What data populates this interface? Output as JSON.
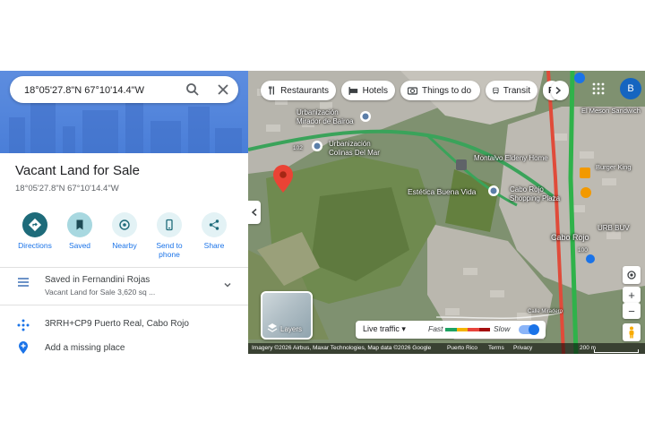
{
  "search": {
    "value": "18°05'27.8\"N 67°10'14.4\"W"
  },
  "place": {
    "title": "Vacant Land for Sale",
    "coordinates": "18°05'27.8\"N 67°10'14.4\"W"
  },
  "actions": [
    {
      "label": "Directions",
      "icon": "directions-icon"
    },
    {
      "label": "Saved",
      "icon": "bookmark-icon"
    },
    {
      "label": "Nearby",
      "icon": "nearby-icon"
    },
    {
      "label": "Send to phone",
      "icon": "phone-icon"
    },
    {
      "label": "Share",
      "icon": "share-icon"
    }
  ],
  "saved": {
    "line1": "Saved in Fernandini Rojas",
    "line2": "Vacant Land for Sale 3,620 sq ..."
  },
  "plus_code": "3RRH+CP9 Puerto Real, Cabo Rojo",
  "add_place": "Add a missing place",
  "map": {
    "chips": [
      "Restaurants",
      "Hotels",
      "Things to do",
      "Transit",
      "P"
    ],
    "avatar": "B",
    "layers_label": "Layers",
    "traffic": {
      "live": "Live traffic",
      "fast": "Fast",
      "slow": "Slow"
    },
    "labels": {
      "mirador": "Urbanización\nMirador de Bairoa",
      "colinas": "Urbanización\nColinas Del Mar",
      "montalvo": "Montalvo Eldeny Home",
      "estetica": "Estética Buena Vida",
      "cabo_plaza": "Cabo Rojo\nShopping Plaza",
      "cabo": "Cabo Rojo",
      "urb": "URB BUV",
      "calle": "Calle Miradero",
      "meson": "El Meson Sandwich",
      "burger": "Burger King",
      "road102": "102",
      "road100": "100"
    },
    "footer": {
      "imagery": "Imagery ©2026 Airbus, Maxar Technologies, Map data ©2026 Google",
      "region": "Puerto Rico",
      "terms": "Terms",
      "privacy": "Privacy",
      "scale": "200 m"
    }
  },
  "colors": {
    "accent": "#1a73e8",
    "teal": "#1e6b7a",
    "pin": "#ea4335",
    "highway": "#2fb24a"
  }
}
